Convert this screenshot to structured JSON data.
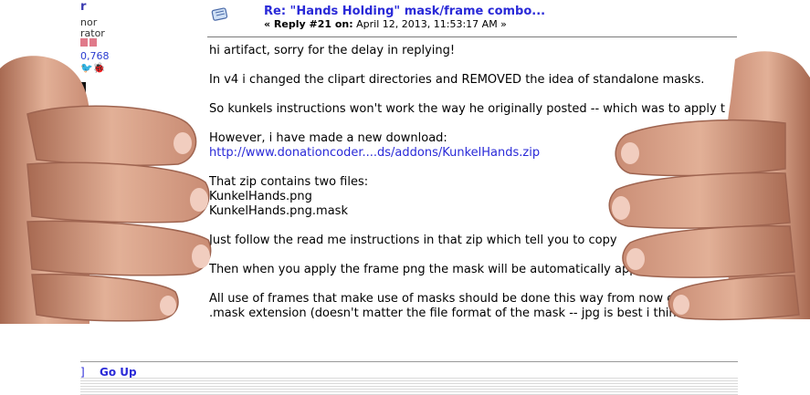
{
  "author": {
    "name_fragment": "r",
    "rank_fragment_1": "nor",
    "rank_fragment_2": "rator",
    "posts_fragment": "0,768"
  },
  "post": {
    "title": "Re: \"Hands Holding\" mask/frame combo...",
    "reply_label": "« Reply #21 on:",
    "date": "April 12, 2013, 11:53:17 AM »"
  },
  "body": {
    "greeting": "hi artifact, sorry for the delay in replying!",
    "p2": "In v4 i changed the clipart directories and REMOVED the idea of standalone masks.",
    "p3": "So kunkels instructions won't work the way he originally posted -- which was to apply t",
    "p4_intro": "However, i have made a new download:",
    "p4_link": "http://www.donationcoder....ds/addons/KunkelHands.zip",
    "p5_intro": "That zip contains two files:",
    "p5_file1": "KunkelHands.png",
    "p5_file2": "KunkelHands.png.mask",
    "p6": "Just follow the read me instructions in that zip which tell you to copy",
    "p7": "Then when you apply the frame png the mask will be automatically applied, a",
    "p8_line1": "All use of frames that make use of masks should be done this way from now on, as a",
    "p8_line2": ".mask extension (doesn't matter the file format of the mask -- jpg is best i think)."
  },
  "footer": {
    "bracket": "]",
    "go_up": "Go Up"
  },
  "colors": {
    "link": "#2a2ad8",
    "skin": "#e6b49a",
    "skin_shadow": "#b5806a"
  }
}
